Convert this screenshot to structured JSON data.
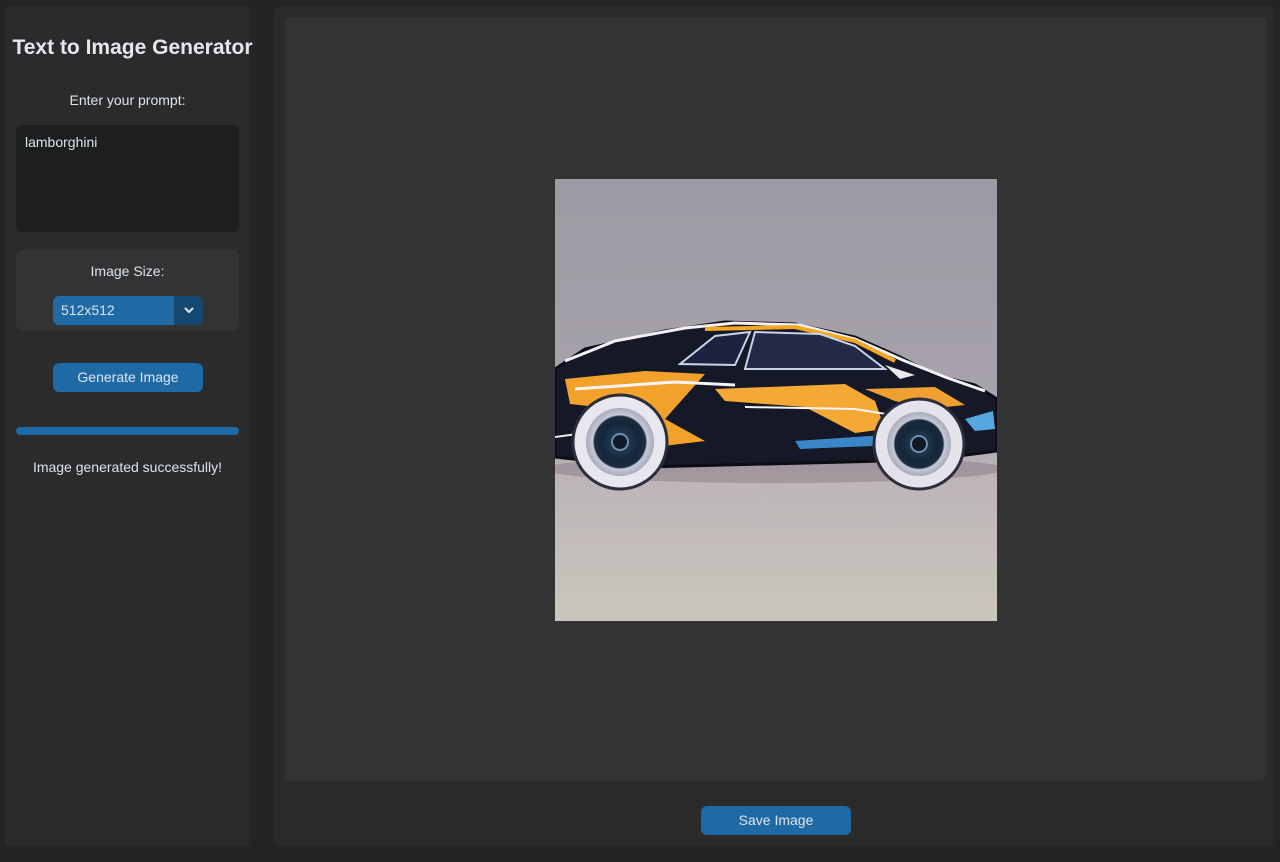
{
  "app": {
    "title": "Text to Image Generator"
  },
  "sidebar": {
    "prompt_label": "Enter your prompt:",
    "prompt_value": "lamborghini",
    "size_label": "Image Size:",
    "size_selected": "512x512",
    "generate_label": "Generate Image",
    "progress": 1.0,
    "status": "Image generated successfully!"
  },
  "main": {
    "save_label": "Save Image",
    "image_subject": "lamborghini"
  },
  "colors": {
    "accent": "#1f6aa5",
    "accent_dark": "#144870",
    "background": "#242424",
    "panel": "#2b2b2b",
    "frame": "#333333",
    "textbox": "#1d1e1e"
  },
  "icons": {
    "dropdown": "chevron-down-icon"
  }
}
